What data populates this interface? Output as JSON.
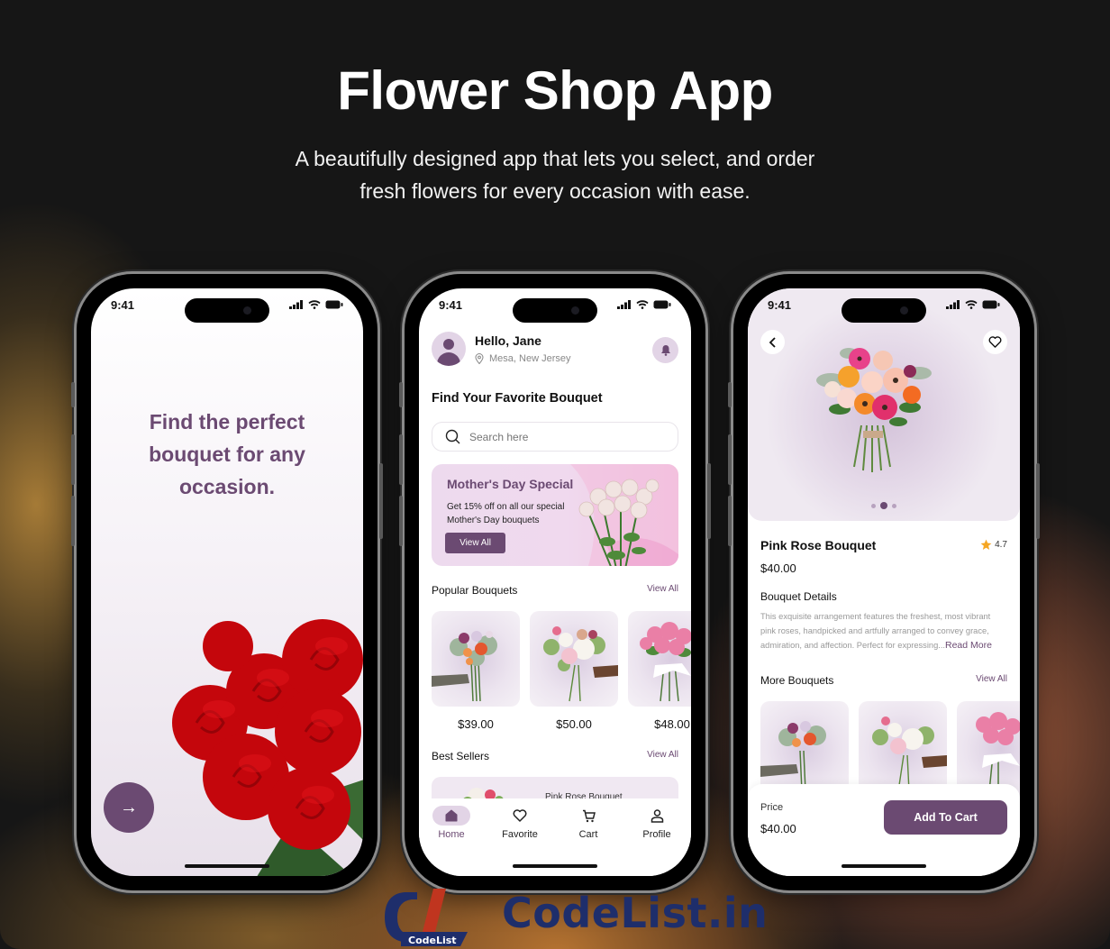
{
  "hero": {
    "title": "Flower Shop App",
    "subtitle_line1": "A beautifully designed app that lets you select, and order",
    "subtitle_line2": "fresh flowers for every occasion with ease."
  },
  "colors": {
    "brand": "#6b4a72",
    "brand_light": "#e2d4e6",
    "star": "#f5a623",
    "logo_blue": "#1e2e6b",
    "logo_red": "#c0351f"
  },
  "status_bar": {
    "time": "9:41"
  },
  "onboarding": {
    "tagline_line1": "Find the perfect",
    "tagline_line2": "bouquet for any",
    "tagline_line3": "occasion.",
    "next_icon": "arrow-right-icon",
    "next_glyph": "→"
  },
  "home": {
    "greeting": "Hello, Jane",
    "location": "Mesa, New Jersey",
    "section_title": "Find Your Favorite Bouquet",
    "search_placeholder": "Search here",
    "promo": {
      "title": "Mother's Day Special",
      "text_line1": "Get 15% off on all our special",
      "text_line2": "Mother's Day bouquets",
      "button": "View All"
    },
    "popular": {
      "title": "Popular Bouquets",
      "view_all": "View All",
      "items": [
        {
          "price": "$39.00"
        },
        {
          "price": "$50.00"
        },
        {
          "price": "$48.00"
        }
      ]
    },
    "best_sellers": {
      "title": "Best Sellers",
      "view_all": "View All",
      "first_item_name": "Pink Rose Bouquet"
    },
    "tabs": [
      {
        "label": "Home",
        "icon": "home-icon",
        "active": true
      },
      {
        "label": "Favorite",
        "icon": "heart-icon",
        "active": false
      },
      {
        "label": "Cart",
        "icon": "cart-icon",
        "active": false
      },
      {
        "label": "Profile",
        "icon": "user-icon",
        "active": false
      }
    ]
  },
  "detail": {
    "name": "Pink Rose Bouquet",
    "rating": "4.7",
    "price": "$40.00",
    "details_title": "Bouquet Details",
    "description": "This exquisite arrangement features the freshest, most vibrant pink roses, handpicked and artfully arranged to convey grace, admiration, and affection. Perfect for expressing...",
    "read_more": "Read More",
    "more_title": "More Bouquets",
    "more_view_all": "View All",
    "carousel": {
      "count": 3,
      "active_index": 1
    },
    "bottom": {
      "price_label": "Price",
      "price_value": "$40.00",
      "button": "Add To Cart"
    }
  },
  "logo": {
    "word": "CodeList.in",
    "badge": "CodeList"
  }
}
